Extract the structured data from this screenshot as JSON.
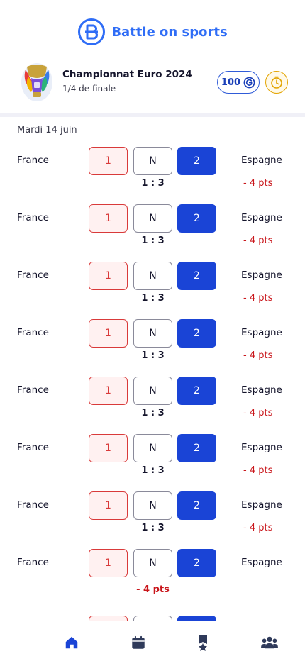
{
  "app": {
    "name": "Battle on sports",
    "brand_color": "#2f6df6"
  },
  "competition": {
    "title": "Championnat Euro 2024",
    "round": "1/4 de finale",
    "coins": "100",
    "coin_icon": "coin-icon",
    "timer_icon": "stopwatch-icon"
  },
  "date": "Mardi 14 juin",
  "matches": [
    {
      "home": "France",
      "away": "Espagne",
      "bet_1": "1",
      "bet_n": "N",
      "bet_2": "2",
      "score": "1 : 3",
      "points": "- 4 pts"
    },
    {
      "home": "France",
      "away": "Espagne",
      "bet_1": "1",
      "bet_n": "N",
      "bet_2": "2",
      "score": "1 : 3",
      "points": "- 4 pts"
    },
    {
      "home": "France",
      "away": "Espagne",
      "bet_1": "1",
      "bet_n": "N",
      "bet_2": "2",
      "score": "1 : 3",
      "points": "- 4 pts"
    },
    {
      "home": "France",
      "away": "Espagne",
      "bet_1": "1",
      "bet_n": "N",
      "bet_2": "2",
      "score": "1 : 3",
      "points": "- 4 pts"
    },
    {
      "home": "France",
      "away": "Espagne",
      "bet_1": "1",
      "bet_n": "N",
      "bet_2": "2",
      "score": "1 : 3",
      "points": "- 4 pts"
    },
    {
      "home": "France",
      "away": "Espagne",
      "bet_1": "1",
      "bet_n": "N",
      "bet_2": "2",
      "score": "1 : 3",
      "points": "- 4 pts"
    },
    {
      "home": "France",
      "away": "Espagne",
      "bet_1": "1",
      "bet_n": "N",
      "bet_2": "2",
      "score": "1 : 3",
      "points": "- 4 pts"
    },
    {
      "home": "France",
      "away": "Espagne",
      "bet_1": "1",
      "bet_n": "N",
      "bet_2": "2",
      "points": "- 4 pts"
    }
  ],
  "colors": {
    "bet_lost_border": "#d93a3a",
    "bet_selected": "#1a44d6",
    "points_negative": "#c9161b",
    "timer_accent": "#e3a400"
  },
  "bottom_nav": [
    {
      "icon": "home-icon",
      "active": true
    },
    {
      "icon": "calendar-icon",
      "active": false
    },
    {
      "icon": "award-ribbon-icon",
      "active": false
    },
    {
      "icon": "users-group-icon",
      "active": false
    }
  ]
}
